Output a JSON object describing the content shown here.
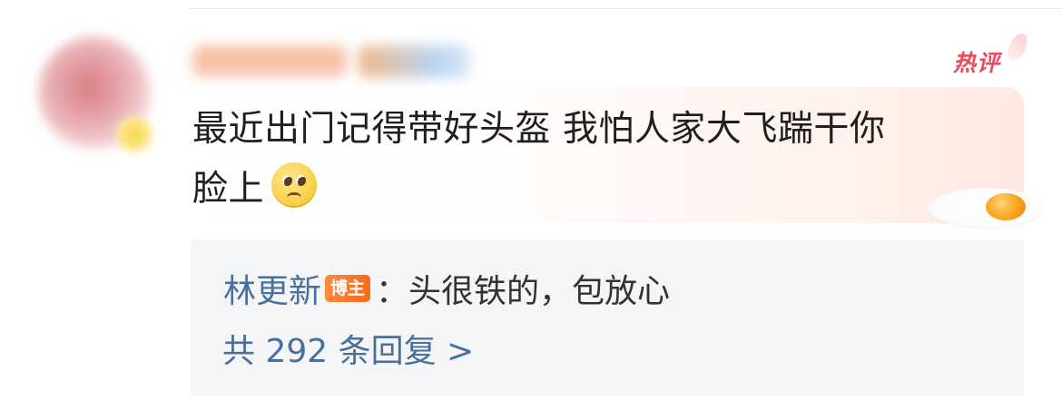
{
  "comment": {
    "hot_label": "热评",
    "text_line1": "最近出门记得带好头盔 我怕人家大飞踹干你",
    "text_line2": "脸上",
    "emoji": "sad-face-emoji"
  },
  "reply": {
    "author": "林更新",
    "author_badge": "博主",
    "separator": "：",
    "text": "头很铁的，包放心",
    "count_label": "共 292 条回复 >"
  },
  "colors": {
    "hot_label": "#f0495a",
    "link": "#4a6f9d",
    "badge": "#f76b1c",
    "reply_bg": "#f4f5f7"
  }
}
